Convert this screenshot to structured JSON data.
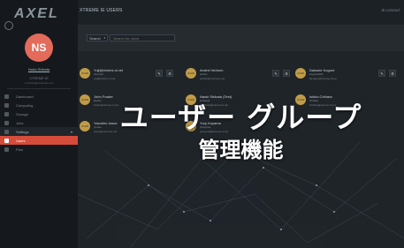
{
  "app": {
    "logo": "AXEL"
  },
  "topbar": {
    "title": "XTREME IE USERS",
    "right": "☰ LOGOUT"
  },
  "sidebar": {
    "avatar_initials": "NS",
    "user_name": "Nada Shibata",
    "user_role": "XTREME IE",
    "user_email": "n.shibata@example.com",
    "menu": [
      {
        "label": "Dashboard"
      },
      {
        "label": "Computing"
      },
      {
        "label": "Storage"
      },
      {
        "label": "Jobs"
      },
      {
        "label": "Settings",
        "caret": "▾"
      },
      {
        "label": "Users"
      },
      {
        "label": "Plan"
      }
    ]
  },
  "toolbar": {
    "filter_label": "Search",
    "search_placeholder": "Search for users"
  },
  "users": [
    {
      "initials": "JOHN",
      "name": "Yuji@xtreme-d.net",
      "sub": "xtreme3",
      "email": "yuji@xtreme-d.net"
    },
    {
      "initials": "JOHN",
      "name": "Andrei Vedrom",
      "sub": "andrei",
      "email": "andrei@xtreme-d.net"
    },
    {
      "initials": "JOHN",
      "name": "Daisuke Kogure",
      "sub": "kogure0011",
      "email": "dkogure@xtreme-d.net"
    },
    {
      "initials": "JOHN",
      "name": "John Fowler",
      "sub": "jfowler",
      "email": "fowler@xtreme-d.net"
    },
    {
      "initials": "JOHN",
      "name": "Naoki Shibata (Test)",
      "sub": "shibata4",
      "email": "n.shibata@xtreme-d.net"
    },
    {
      "initials": "JOHN",
      "name": "Ishiko Chihara",
      "sub": "chihara",
      "email": "chihara@xtreme-d.net"
    },
    {
      "initials": "JOHN",
      "name": "Yasuhiro Inoue",
      "sub": "yinoue",
      "email": "yasu@xtreme-d.net"
    },
    {
      "initials": "JOHN",
      "name": "Yury Koyama",
      "sub": "ykoyama",
      "email": "ykoyama@xtreme-d.net"
    }
  ],
  "overlay": {
    "title": "ユーザー グループ",
    "subtitle": "管理機能"
  },
  "colors": {
    "accent": "#d64b3a",
    "avatar": "#e36b5b",
    "user_avatar": "#c8a24a"
  }
}
